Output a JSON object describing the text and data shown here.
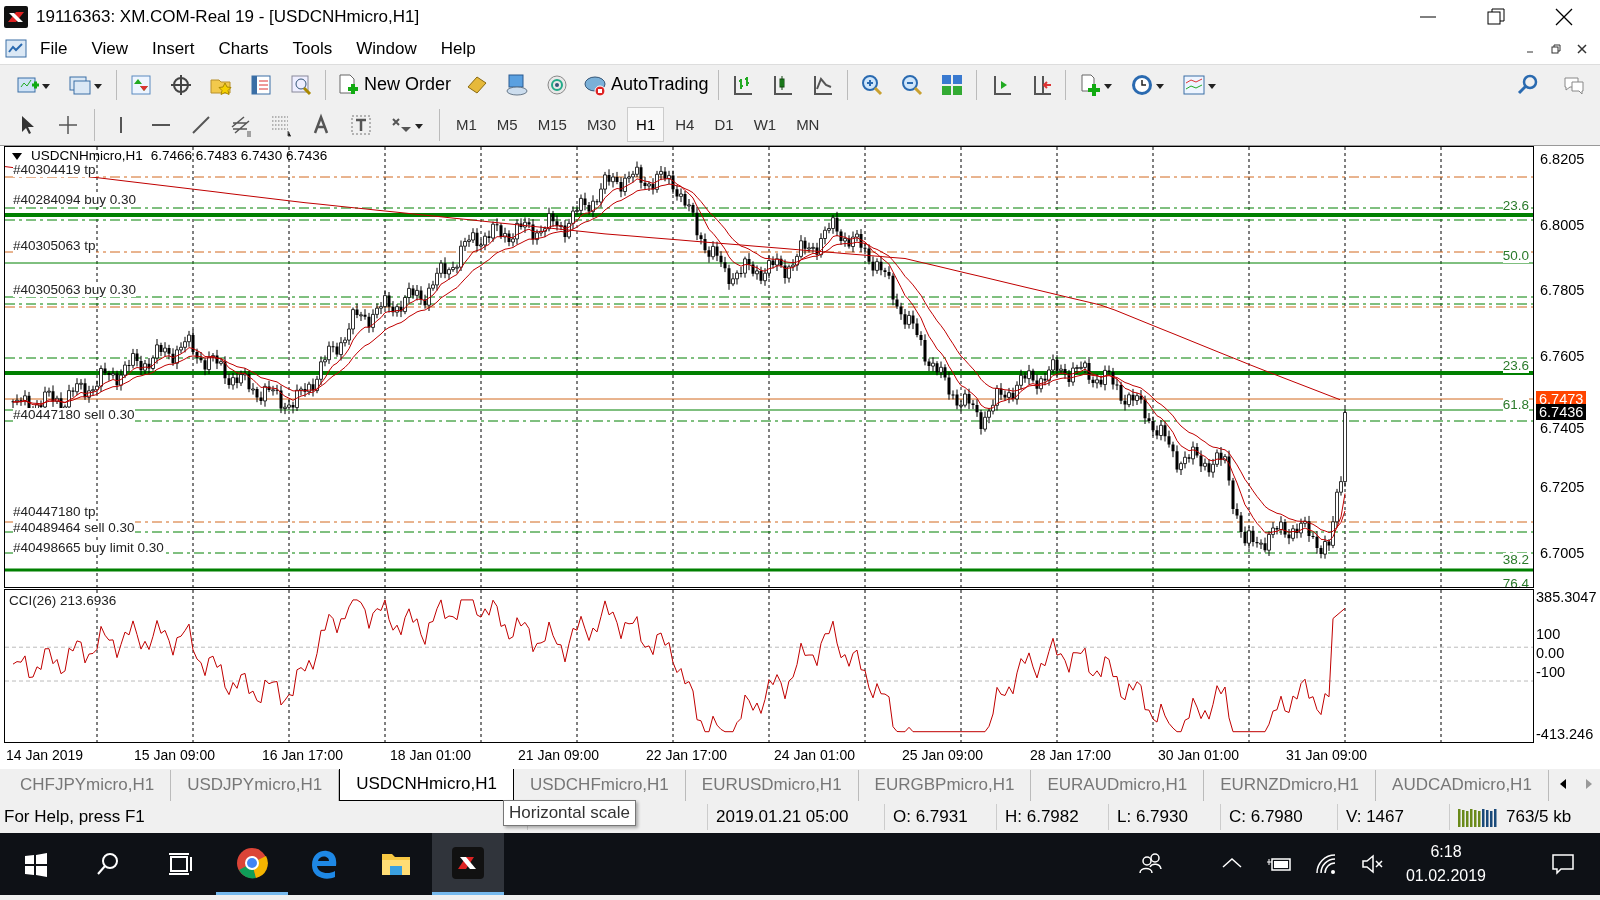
{
  "window": {
    "title": "19116363: XM.COM-Real 19 - [USDCNHmicro,H1]"
  },
  "menu": [
    "File",
    "View",
    "Insert",
    "Charts",
    "Tools",
    "Window",
    "Help"
  ],
  "toolbar": {
    "new_order": "New Order",
    "auto_trading": "AutoTrading"
  },
  "periods": [
    {
      "label": "M1",
      "selected": false
    },
    {
      "label": "M5",
      "selected": false
    },
    {
      "label": "M15",
      "selected": false
    },
    {
      "label": "M30",
      "selected": false
    },
    {
      "label": "H1",
      "selected": true
    },
    {
      "label": "H4",
      "selected": false
    },
    {
      "label": "D1",
      "selected": false
    },
    {
      "label": "W1",
      "selected": false
    },
    {
      "label": "MN",
      "selected": false
    }
  ],
  "chart": {
    "symbol": "USDCNHmicro,H1",
    "ohlc": "6.7466 6.7483 6.7430 6.7436",
    "order_labels": [
      "#40304419 tp",
      "#40284094 buy 0.30",
      "#40305063 tp",
      "#40305063 buy 0.30",
      "#40447180 sell 0.30",
      "#40447180 tp",
      "#40489464 sell 0.30",
      "#40498665 buy limit 0.30"
    ],
    "fib_labels": [
      "23.6",
      "50.0",
      "23.6",
      "61.8",
      "38.2",
      "76.4"
    ],
    "price_scale": [
      "6.8205",
      "6.8005",
      "6.7805",
      "6.7605",
      "6.7405",
      "6.7205",
      "6.7005"
    ],
    "ask_price": "6.7473",
    "bid_price": "6.7436",
    "indicator": {
      "label": "CCI(26) 213.6936",
      "scale": [
        "385.3047",
        "100",
        "0.00",
        "-100",
        "-413.246"
      ]
    },
    "time_scale": [
      "14 Jan 2019",
      "15 Jan 09:00",
      "16 Jan 17:00",
      "18 Jan 01:00",
      "21 Jan 09:00",
      "22 Jan 17:00",
      "24 Jan 01:00",
      "25 Jan 09:00",
      "28 Jan 17:00",
      "30 Jan 01:00",
      "31 Jan 09:00"
    ]
  },
  "tabs": [
    {
      "label": "CHFJPYmicro,H1",
      "selected": false
    },
    {
      "label": "USDJPYmicro,H1",
      "selected": false
    },
    {
      "label": "USDCNHmicro,H1",
      "selected": true
    },
    {
      "label": "USDCHFmicro,H1",
      "selected": false
    },
    {
      "label": "EURUSDmicro,H1",
      "selected": false
    },
    {
      "label": "EURGBPmicro,H1",
      "selected": false
    },
    {
      "label": "EURAUDmicro,H1",
      "selected": false
    },
    {
      "label": "EURNZDmicro,H1",
      "selected": false
    },
    {
      "label": "AUDCADmicro,H1",
      "selected": false
    }
  ],
  "tooltip": "Horizontal scale",
  "status": {
    "help": "For Help, press F1",
    "datetime": "2019.01.21 05:00",
    "open": "O: 6.7931",
    "high": "H: 6.7982",
    "low": "L: 6.7930",
    "close": "C: 6.7980",
    "volume": "V: 1467",
    "traffic": "763/5 kb"
  },
  "taskbar": {
    "time": "6:18",
    "date": "01.02.2019"
  }
}
